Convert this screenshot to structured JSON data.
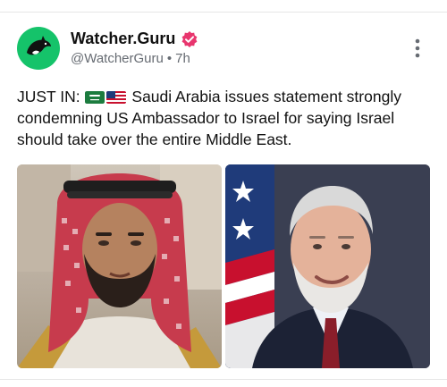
{
  "post": {
    "author": {
      "display_name": "Watcher.Guru",
      "handle": "@WatcherGuru",
      "separator": "•",
      "time": "7h",
      "avatar_icon": "orca-icon",
      "verified_icon": "verified-badge-icon"
    },
    "text": {
      "prefix": "JUST IN: ",
      "flags": [
        "saudi-arabia-flag",
        "usa-flag"
      ],
      "body": "Saudi Arabia issues statement strongly condemning US Ambassador to Israel for saying Israel should take over the entire Middle East."
    },
    "media": [
      {
        "name": "photo-saudi-crown-prince"
      },
      {
        "name": "photo-us-ambassador"
      }
    ]
  },
  "colors": {
    "avatar_bg": "#15c36a",
    "verified": "#e8366e",
    "text": "#111111",
    "muted": "#666b72"
  }
}
